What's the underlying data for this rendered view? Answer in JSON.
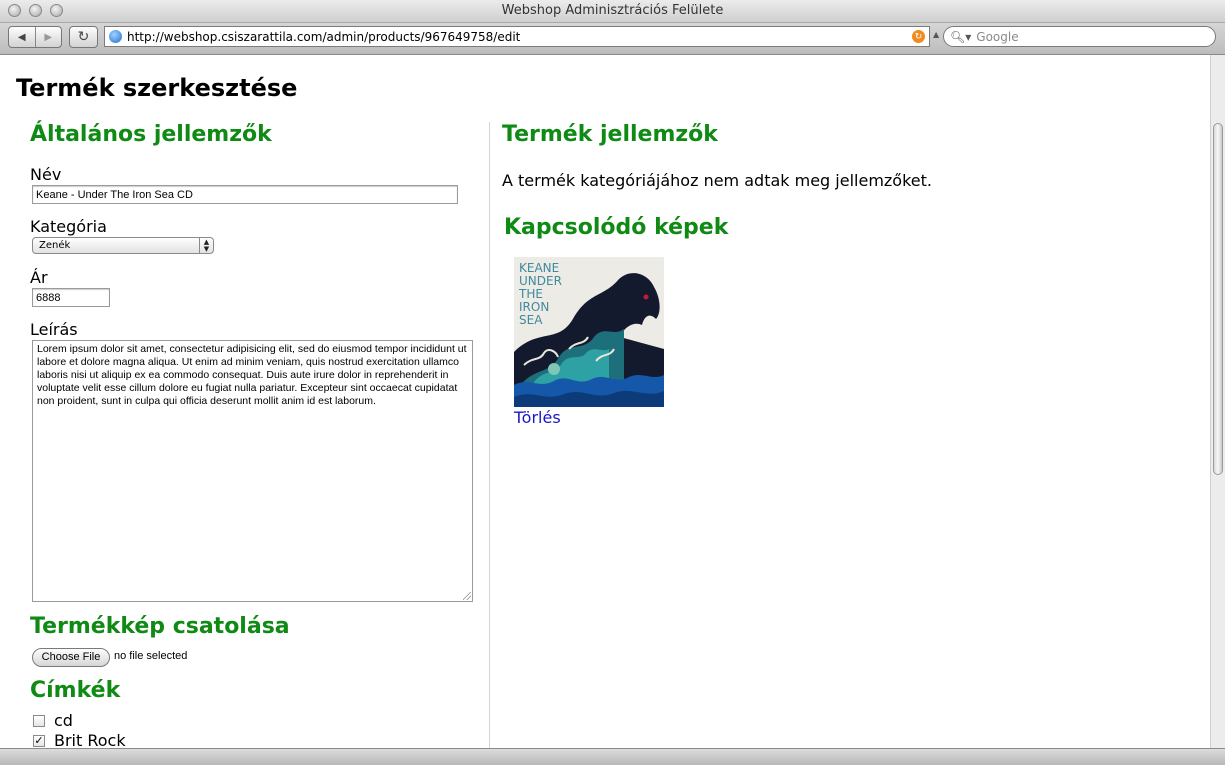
{
  "window": {
    "title": "Webshop Adminisztrációs Felülete"
  },
  "toolbar": {
    "back_glyph": "◀",
    "forward_glyph": "▶",
    "reload_glyph": "↻",
    "url": "http://webshop.csiszarattila.com/admin/products/967649758/edit",
    "search_placeholder": "Google"
  },
  "page": {
    "title": "Termék szerkesztése"
  },
  "general": {
    "heading": "Általános jellemzők",
    "name_label": "Név",
    "name_value": "Keane - Under The Iron Sea CD",
    "category_label": "Kategória",
    "category_selected": "Zenék",
    "price_label": "Ár",
    "price_value": "6888",
    "description_label": "Leírás",
    "description_value": "Lorem ipsum dolor sit amet, consectetur adipisicing elit, sed do eiusmod tempor incididunt ut labore et dolore magna aliqua. Ut enim ad minim veniam, quis nostrud exercitation ullamco laboris nisi ut aliquip ex ea commodo consequat. Duis aute irure dolor in reprehenderit in voluptate velit esse cillum dolore eu fugiat nulla pariatur. Excepteur sint occaecat cupidatat non proident, sunt in culpa qui officia deserunt mollit anim id est laborum."
  },
  "image_upload": {
    "heading": "Termékkép csatolása",
    "button_label": "Choose File",
    "status": "no file selected"
  },
  "tags": {
    "heading": "Címkék",
    "items": [
      {
        "label": "cd",
        "checked": false
      },
      {
        "label": "Brit Rock",
        "checked": true
      }
    ]
  },
  "attributes": {
    "heading": "Termék jellemzők",
    "message": "A termék kategóriájához nem adtak meg jellemzőket."
  },
  "related_images": {
    "heading": "Kapcsolódó képek",
    "album_text": [
      "KEANE",
      "UNDER",
      "THE",
      "IRON",
      "SEA"
    ],
    "delete_label": "Törlés"
  },
  "colors": {
    "heading_green": "#0f8a14",
    "link_blue": "#1a16c9"
  }
}
